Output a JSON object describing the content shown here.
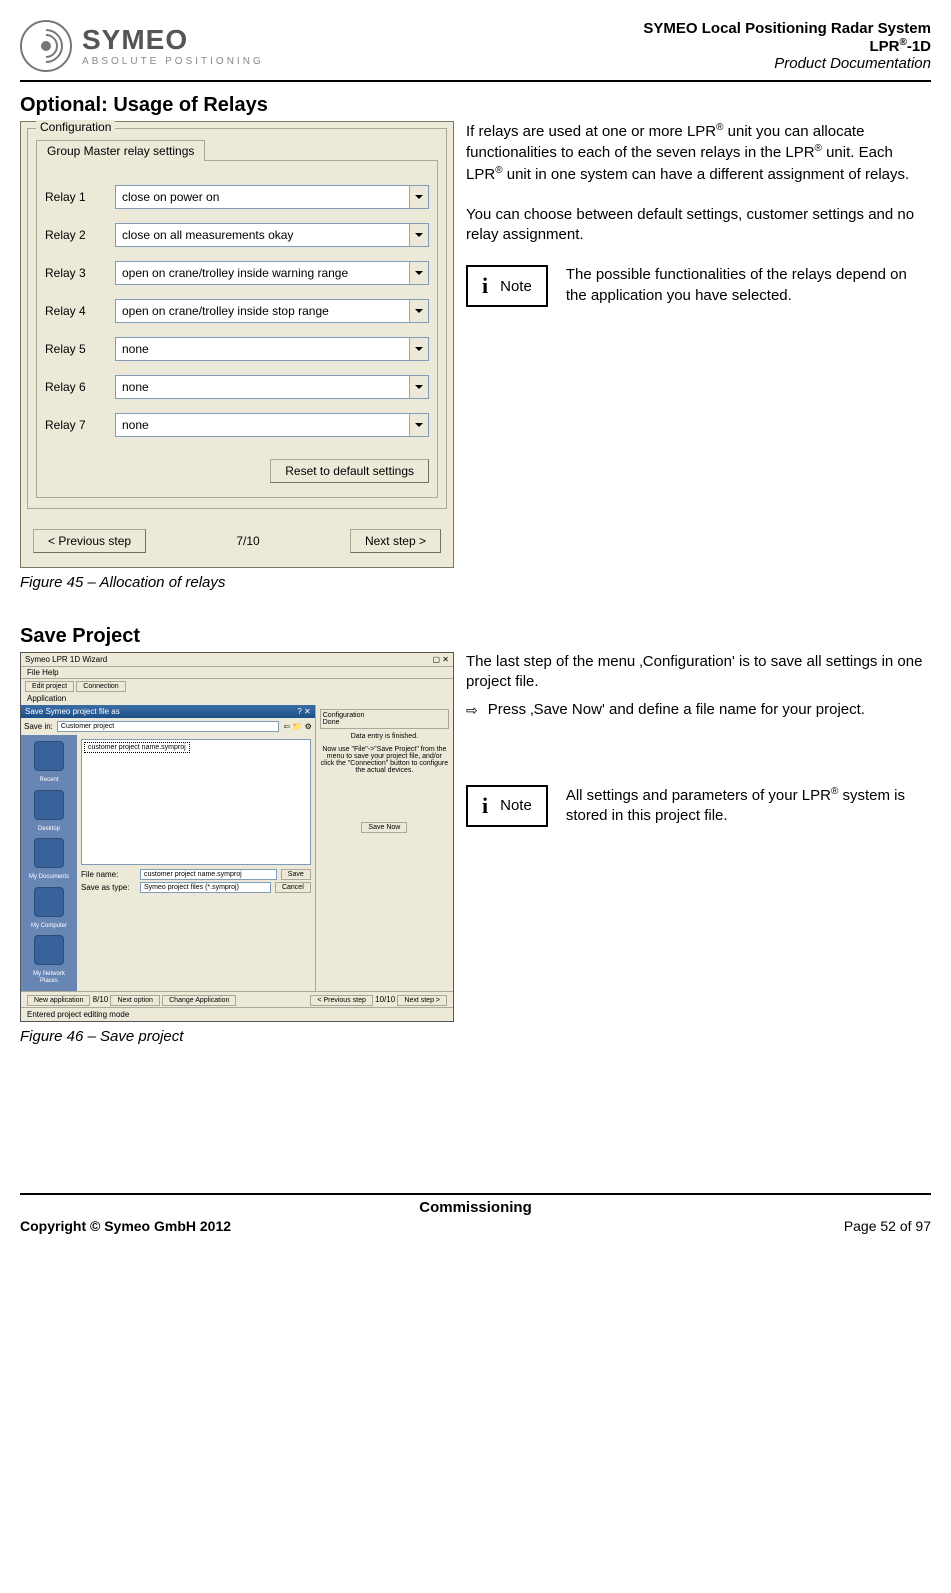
{
  "header": {
    "logo_name": "SYMEO",
    "logo_sub": "ABSOLUTE POSITIONING",
    "line1": "SYMEO Local Positioning Radar System",
    "line2_prefix": "LPR",
    "line2_sup": "®",
    "line2_suffix": "-1D",
    "line3": "Product Documentation"
  },
  "section1": {
    "title": "Optional: Usage of Relays",
    "caption": "Figure 45 – Allocation of relays",
    "para1_a": "If relays are used at one or more LPR",
    "para1_b": " unit you can allocate functionalities to each of the seven relays in the LPR",
    "para1_c": " unit. Each LPR",
    "para1_d": " unit in one system can have a different assignment of relays.",
    "para2": "You can choose between default settings, customer settings and no relay assignment.",
    "note_label": "Note",
    "note_text": "The possible functionalities of the relays depend on the application you have selected."
  },
  "dialog": {
    "group_legend": "Configuration",
    "tab_label": "Group Master relay settings",
    "reset_btn": "Reset to default settings",
    "prev_btn": "< Previous step",
    "step_text": "7/10",
    "next_btn": "Next step >",
    "relays": [
      {
        "label": "Relay 1",
        "value": "close on power on"
      },
      {
        "label": "Relay 2",
        "value": "close on all measurements okay"
      },
      {
        "label": "Relay 3",
        "value": "open on crane/trolley inside warning range"
      },
      {
        "label": "Relay 4",
        "value": "open on crane/trolley inside stop range"
      },
      {
        "label": "Relay 5",
        "value": "none"
      },
      {
        "label": "Relay 6",
        "value": "none"
      },
      {
        "label": "Relay 7",
        "value": "none"
      }
    ]
  },
  "section2": {
    "title": "Save Project",
    "caption": "Figure 46 – Save project",
    "para1": "The last step of the menu ‚Configuration' is to save all settings in one project file.",
    "bullet": "Press ‚Save Now' and define a file name for your project.",
    "note_label": "Note",
    "note_text_a": "All settings and parameters of your LPR",
    "note_text_b": " system is stored in this project file."
  },
  "mini": {
    "wiz_title": "Symeo LPR 1D Wizard",
    "menubar": "File   Help",
    "tab1": "Edit project",
    "tab2": "Connection",
    "app_lbl": "Application",
    "right_head": "Configuration",
    "right_sub": "Done",
    "right_t1": "Data entry is finished.",
    "right_t2": "Now use \"File\"->\"Save Project\" from the menu to save your project file, and/or click the \"Connection\" button to configure the actual devices.",
    "save_title": "Save Symeo project file as",
    "savein_lbl": "Save in:",
    "savein_val": "Customer project",
    "list_item": "customer project name.symproj",
    "fname_lbl": "File name:",
    "fname_val": "customer project name.symproj",
    "type_lbl": "Save as type:",
    "type_val": "Symeo project files (*.symproj)",
    "save_btn": "Save",
    "cancel_btn": "Cancel",
    "save_now_btn": "Save Now",
    "side": [
      "Recent",
      "Desktop",
      "My Documents",
      "My Computer",
      "My Network Places"
    ],
    "lb_new": "New application",
    "lb_step": "8/10",
    "lb_next": "Next option",
    "lb_change": "Change Application",
    "lb_prev": "< Previous step",
    "lb_step2": "10/10",
    "lb_next2": "Next step >",
    "status": "Entered project editing mode"
  },
  "footer": {
    "center": "Commissioning",
    "left": "Copyright © Symeo GmbH 2012",
    "right": "Page 52 of 97"
  },
  "sup": "®"
}
